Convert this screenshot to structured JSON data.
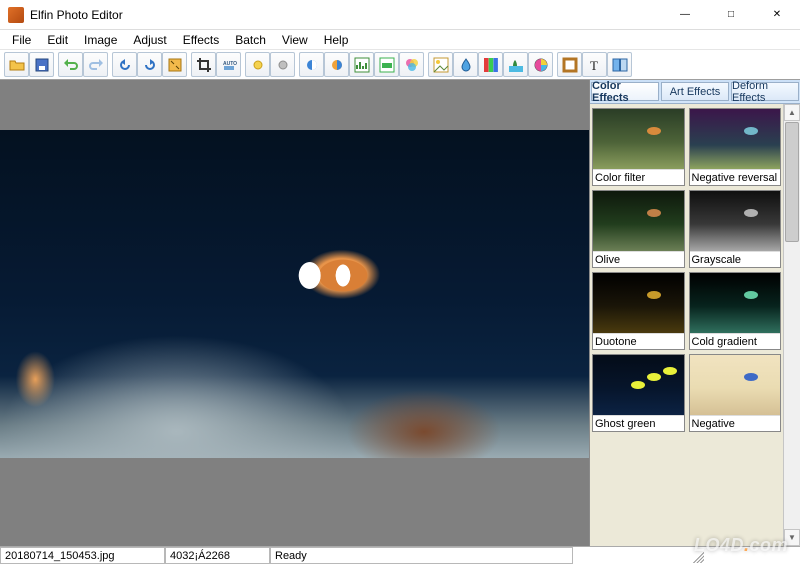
{
  "window": {
    "title": "Elfin Photo Editor"
  },
  "menubar": [
    {
      "label": "File"
    },
    {
      "label": "Edit"
    },
    {
      "label": "Image"
    },
    {
      "label": "Adjust"
    },
    {
      "label": "Effects"
    },
    {
      "label": "Batch"
    },
    {
      "label": "View"
    },
    {
      "label": "Help"
    }
  ],
  "toolbar_groups": [
    [
      "open",
      "save"
    ],
    [
      "undo",
      "redo"
    ],
    [
      "rotate-left",
      "rotate-right",
      "resize"
    ],
    [
      "crop",
      "auto-adjust"
    ],
    [
      "light-plus",
      "light-minus"
    ],
    [
      "pie-contrast",
      "pie-saturation",
      "histogram",
      "levels-green",
      "color-balance"
    ],
    [
      "sun",
      "drop",
      "rgb",
      "palm",
      "color-wheel"
    ],
    [
      "frame",
      "text",
      "compare"
    ]
  ],
  "side_tabs": [
    {
      "label": "Color Effects",
      "active": true
    },
    {
      "label": "Art Effects",
      "active": false
    },
    {
      "label": "Deform Effects",
      "active": false
    }
  ],
  "effects": [
    {
      "label": "Color filter",
      "theme": "th-colorfilter"
    },
    {
      "label": "Negative reversal film",
      "theme": "th-negative"
    },
    {
      "label": "Olive",
      "theme": "th-olive"
    },
    {
      "label": "Grayscale",
      "theme": "th-grayscale"
    },
    {
      "label": "Duotone",
      "theme": "th-duotone"
    },
    {
      "label": "Cold gradient",
      "theme": "th-cold"
    },
    {
      "label": "Ghost green",
      "theme": "th-ghost"
    },
    {
      "label": "Negative",
      "theme": "th-neg2"
    }
  ],
  "statusbar": {
    "filename": "20180714_150453.jpg",
    "dimensions": "4032¡Á2268",
    "status": "Ready"
  },
  "watermark": "LO4D.com"
}
